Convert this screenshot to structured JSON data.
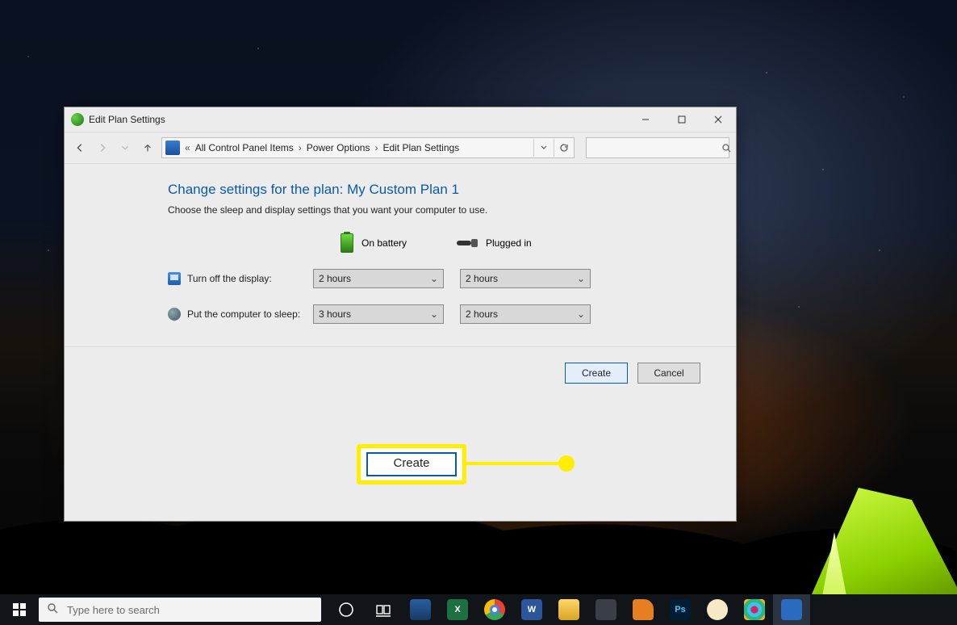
{
  "window": {
    "title": "Edit Plan Settings",
    "breadcrumb": {
      "prefix": "«",
      "items": [
        "All Control Panel Items",
        "Power Options",
        "Edit Plan Settings"
      ]
    }
  },
  "page": {
    "header": "Change settings for the plan: My Custom Plan 1",
    "sub": "Choose the sleep and display settings that you want your computer to use.",
    "col_battery": "On battery",
    "col_plugged": "Plugged in",
    "rows": [
      {
        "label": "Turn off the display:",
        "battery": "2 hours",
        "plugged": "2 hours"
      },
      {
        "label": "Put the computer to sleep:",
        "battery": "3 hours",
        "plugged": "2 hours"
      }
    ],
    "btn_create": "Create",
    "btn_cancel": "Cancel"
  },
  "callout": {
    "label": "Create"
  },
  "taskbar": {
    "search_placeholder": "Type here to search",
    "apps": [
      {
        "name": "3d-paint",
        "letter": "",
        "cls": "tile-3d"
      },
      {
        "name": "excel",
        "letter": "X",
        "cls": "tile-x"
      },
      {
        "name": "chrome",
        "letter": "",
        "cls": "tile-chrome"
      },
      {
        "name": "word",
        "letter": "W",
        "cls": "tile-w"
      },
      {
        "name": "file-explorer",
        "letter": "",
        "cls": "tile-fe"
      },
      {
        "name": "duplicate",
        "letter": "",
        "cls": "tile-dup"
      },
      {
        "name": "firefox",
        "letter": "",
        "cls": "tile-fire"
      },
      {
        "name": "photoshop",
        "letter": "Ps",
        "cls": "tile-ps"
      },
      {
        "name": "palette",
        "letter": "",
        "cls": "tile-pal"
      },
      {
        "name": "slack",
        "letter": "",
        "cls": "tile-slack"
      },
      {
        "name": "settings",
        "letter": "",
        "cls": "tile-set"
      }
    ]
  }
}
